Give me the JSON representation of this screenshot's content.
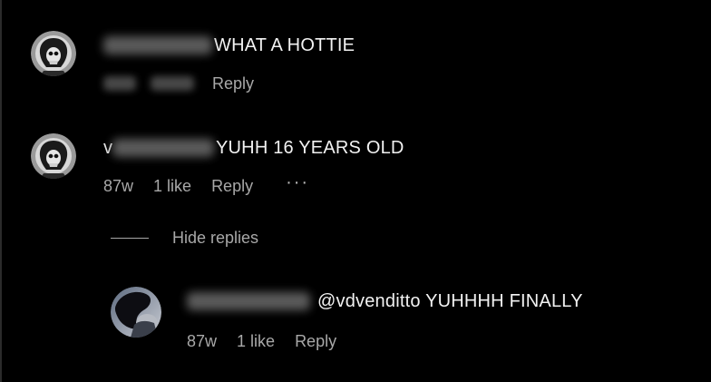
{
  "comments": [
    {
      "username_visible": "",
      "text": "WHAT A HOTTIE",
      "time": "",
      "likes": "",
      "reply_label": "Reply"
    },
    {
      "username_visible": "v",
      "text": "YUHH 16 YEARS OLD",
      "time": "87w",
      "likes": "1 like",
      "reply_label": "Reply",
      "more_label": "···"
    }
  ],
  "hide_replies_label": "Hide replies",
  "reply": {
    "username_visible": "",
    "text": "@vdvenditto YUHHHH FINALLY",
    "time": "87w",
    "likes": "1 like",
    "reply_label": "Reply"
  },
  "colors": {
    "background": "#000000",
    "primary_text": "#f2f2f2",
    "secondary_text": "#a8a8a8"
  },
  "icons": {
    "avatar_1": "skull-avatar-icon",
    "avatar_2": "skull-avatar-icon",
    "avatar_3": "profile-photo-avatar"
  }
}
